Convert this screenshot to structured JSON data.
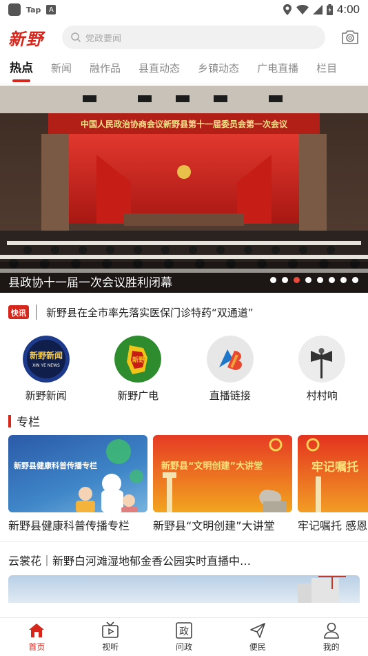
{
  "status_bar": {
    "app_label": "Tap",
    "a_label": "A",
    "time": "4:00"
  },
  "header": {
    "logo": "新野",
    "search_placeholder": "党政要闻"
  },
  "tabs": [
    {
      "label": "热点",
      "active": true
    },
    {
      "label": "新闻"
    },
    {
      "label": "融作品"
    },
    {
      "label": "县直动态"
    },
    {
      "label": "乡镇动态"
    },
    {
      "label": "广电直播"
    },
    {
      "label": "栏目"
    }
  ],
  "banner": {
    "stage_banner": "中国人民政治协商会议新野县第十一届委员会第一次会议",
    "caption": "县政协十一届一次会议胜利闭幕",
    "slide_count": 8,
    "active_slide": 3
  },
  "flash": {
    "badge": "快讯",
    "text": "新野县在全市率先落实医保门诊特药“双通道”"
  },
  "shortcuts": [
    {
      "label": "新野新闻",
      "icon": "xinye-news-icon"
    },
    {
      "label": "新野广电",
      "icon": "xinye-broadcast-icon"
    },
    {
      "label": "直播链接",
      "icon": "live-link-icon"
    },
    {
      "label": "村村响",
      "icon": "village-speaker-icon"
    }
  ],
  "columns_section": {
    "title": "专栏",
    "cards": [
      {
        "title": "新野县健康科普传播专栏",
        "img_text": "新野县健康科普传播专栏"
      },
      {
        "title": "新野县“文明创建”大讲堂",
        "img_text": "新野县“文明创建”大讲堂"
      },
      {
        "title": "牢记嘱托 感恩",
        "img_text": "牢记嘱托"
      }
    ]
  },
  "live": {
    "title": "云裳花｜新野白河滩湿地郁金香公园实时直播中…"
  },
  "bottom_nav": [
    {
      "label": "首页",
      "icon": "home-icon",
      "active": true
    },
    {
      "label": "视听",
      "icon": "tv-icon"
    },
    {
      "label": "问政",
      "icon": "zheng-icon"
    },
    {
      "label": "便民",
      "icon": "send-icon"
    },
    {
      "label": "我的",
      "icon": "user-icon"
    }
  ],
  "colors": {
    "accent": "#d7261b",
    "active_dot": "#e84a3c"
  }
}
